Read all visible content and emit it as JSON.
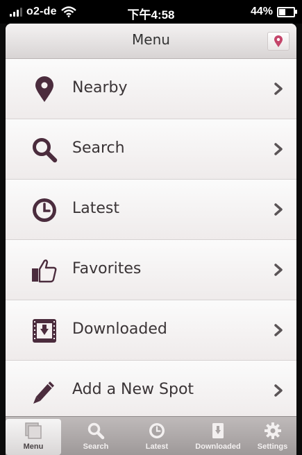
{
  "status_bar": {
    "carrier": "o2-de",
    "time": "下午4:58",
    "battery": "44%",
    "battery_level": 0.44
  },
  "navbar": {
    "title": "Menu"
  },
  "menu": {
    "items": [
      {
        "label": "Nearby",
        "icon": "map-pin-icon"
      },
      {
        "label": "Search",
        "icon": "magnifier-icon"
      },
      {
        "label": "Latest",
        "icon": "clock-icon"
      },
      {
        "label": "Favorites",
        "icon": "thumbs-up-icon"
      },
      {
        "label": "Downloaded",
        "icon": "download-box-icon"
      },
      {
        "label": "Add a New Spot",
        "icon": "pencil-icon"
      }
    ]
  },
  "tabbar": {
    "tabs": [
      {
        "label": "Menu",
        "icon": "menu-square-icon",
        "active": true
      },
      {
        "label": "Search",
        "icon": "magnifier-icon",
        "active": false
      },
      {
        "label": "Latest",
        "icon": "clock-icon",
        "active": false
      },
      {
        "label": "Downloaded",
        "icon": "download-icon",
        "active": false
      },
      {
        "label": "Settings",
        "icon": "gear-icon",
        "active": false
      }
    ]
  },
  "colors": {
    "icon": "#4b2c3d",
    "pin_accent": "#c4456a"
  }
}
